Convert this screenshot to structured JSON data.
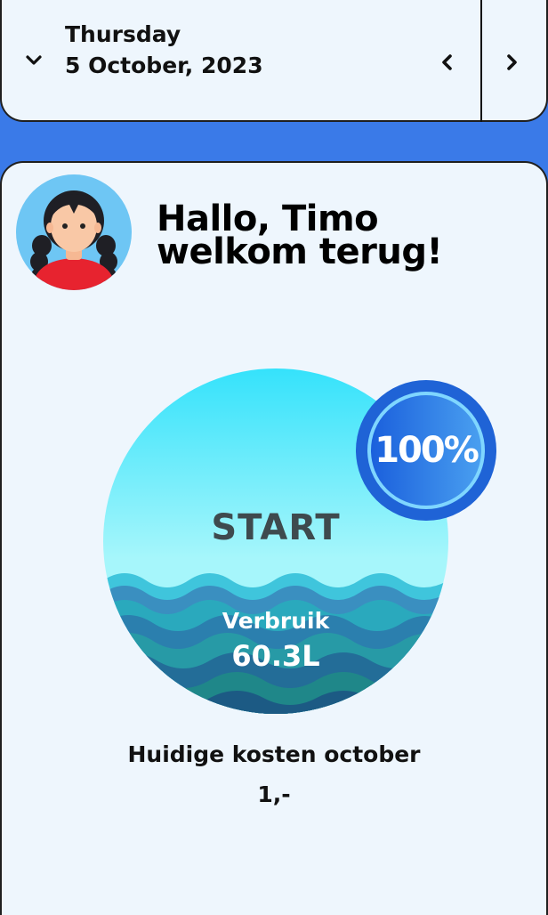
{
  "header": {
    "day": "Thursday",
    "date": "5 October, 2023",
    "icons": {
      "expand": "chevron-down-icon",
      "previous": "chevron-left-icon",
      "next": "chevron-right-icon"
    }
  },
  "greeting": {
    "line1": "Hallo, Timo",
    "line2": "welkom terug!",
    "avatar_icon": "girl-avatar-icon"
  },
  "water": {
    "start_label": "START",
    "usage_label": "Verbruik",
    "usage_value": "60.3L",
    "percent_label": "100%",
    "percent_value": 100
  },
  "costs": {
    "label": "Huidige kosten october",
    "value": "1,-"
  },
  "colors": {
    "background": "#3a7ae8",
    "card": "#eef6fd",
    "water_top": "#35e2fb",
    "water_mid": "#a6f6fb",
    "wave_light": "#37b9d4",
    "wave_dark": "#1f5d86",
    "badge_blue": "#1e69e0",
    "text": "#111111"
  }
}
